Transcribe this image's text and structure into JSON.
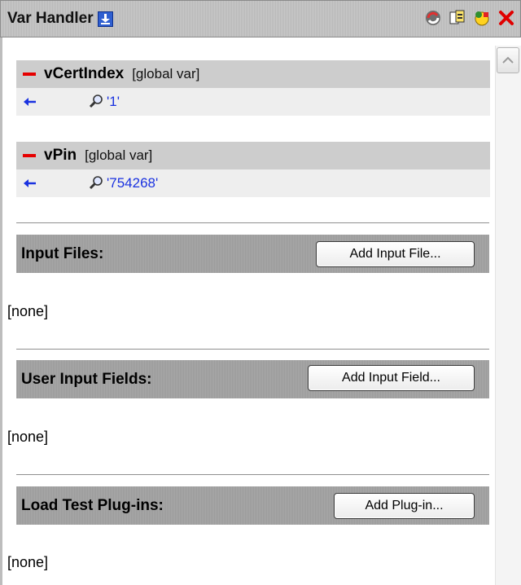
{
  "panel": {
    "title": "Var Handler",
    "title_icon": "download-icon",
    "actions": [
      "refresh-vars-icon",
      "copy-vars-icon",
      "add-var-icon",
      "close-icon"
    ]
  },
  "variables": [
    {
      "name": "vCertIndex",
      "scope": "[global var]",
      "value": "'1'"
    },
    {
      "name": "vPin",
      "scope": "[global var]",
      "value": "'754268'"
    }
  ],
  "sections": {
    "input_files": {
      "label": "Input Files:",
      "button": "Add Input File...",
      "empty": "[none]"
    },
    "user_input_fields": {
      "label": "User Input Fields:",
      "button": "Add Input Field...",
      "empty": "[none]"
    },
    "plugins": {
      "label": "Load Test Plug-ins:",
      "button": "Add Plug-in...",
      "empty": "[none]"
    }
  },
  "colors": {
    "remove_minus": "#e60000",
    "value_text": "#1a32e0",
    "header_bar": "#bcbcbc"
  }
}
